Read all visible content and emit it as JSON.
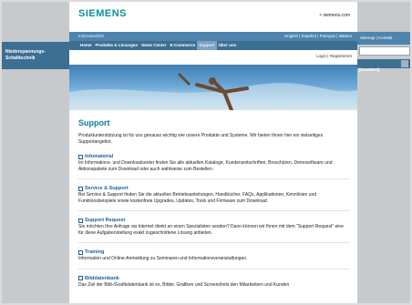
{
  "left": {
    "title": "Niederspannungs-Schalttechnik"
  },
  "header": {
    "logo": "SIEMENS",
    "site_link": "> siemens.com",
    "bar1_left": "Internetauftritt",
    "languages": "English | Español | Français | Italiano",
    "nav": [
      "Home",
      "Produkte & Lösungen",
      "News Center",
      "E-Commerce",
      "Support",
      "Über uns"
    ],
    "login": "Login | Registrieren"
  },
  "right": {
    "links": "Sitemap | Kontakt",
    "search_button": "[Erweitert]"
  },
  "main": {
    "title": "Support",
    "intro": "Produktunterstützung ist für uns genauso wichtig wie unsere Produkte und Systeme. Wir bieten Ihnen hier ein vielseitiges Supportangebot.",
    "sections": [
      {
        "title": "Infomaterial",
        "text": "Im Informations- und Downloadcenter finden Sie alle aktuellen Kataloge, Kundenzeitschriften, Broschüren, Demosoftware und Aktionspakete zum Download oder auch wahlweise zum Bestellen."
      },
      {
        "title": "Service & Support",
        "text": "Bei Service & Support finden Sie die aktuellen Betriebsanleitungen, Handbücher, FAQs, Applikationen, Kennlinien und Funktionsbeispiele sowie kostenfreie Upgrades, Updates, Tools und Firmware zum Download."
      },
      {
        "title": "Support Request",
        "text": "Sie möchten Ihre Anfrage via Internet direkt an einen Spezialisten senden? Dann können wir Ihnen mit dem \"Support Request\" eine für diese Aufgabenstellung exakt zugeschnittene Lösung anbieten."
      },
      {
        "title": "Training",
        "text": "Information und Online-Anmeldung zu Seminaren und Informationsveranstaltungen."
      },
      {
        "title": "Bilddatenbank",
        "text": "Das Ziel der Bild-/Grafikdatenbank ist es, Bilder, Grafiken und Screenshots den Mitarbeitern und Kunden"
      }
    ]
  }
}
